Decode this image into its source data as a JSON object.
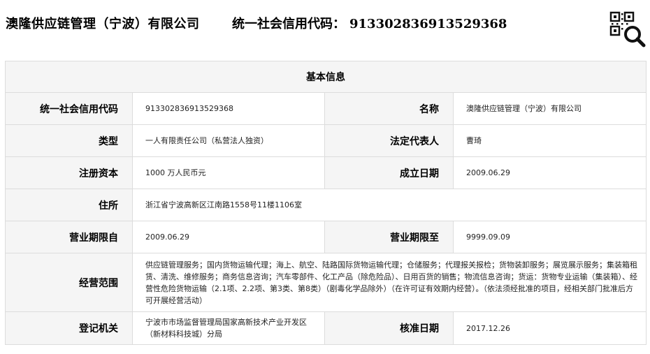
{
  "header": {
    "company_name": "澳隆供应链管理（宁波）有限公司",
    "credit_code_label": "统一社会信用代码：",
    "credit_code_value": "91330283691352936‌8",
    "qr_icon": "qr-code-search-icon"
  },
  "table": {
    "section_title": "基本信息",
    "rows": {
      "credit_code": {
        "label": "统一社会信用代码",
        "value": "913302836913529368"
      },
      "name": {
        "label": "名称",
        "value": "澳隆供应链管理（宁波）有限公司"
      },
      "type": {
        "label": "类型",
        "value": "一人有限责任公司（私营法人独资）"
      },
      "legal_rep": {
        "label": "法定代表人",
        "value": "曹琦"
      },
      "capital": {
        "label": "注册资本",
        "value": "1000 万人民币元"
      },
      "established": {
        "label": "成立日期",
        "value": "2009.06.29"
      },
      "address": {
        "label": "住所",
        "value": "浙江省宁波高新区江南路1558号11楼1106室"
      },
      "term_from": {
        "label": "营业期限自",
        "value": "2009.06.29"
      },
      "term_to": {
        "label": "营业期限至",
        "value": "9999.09.09"
      },
      "scope": {
        "label": "经营范围",
        "value": "供应链管理服务；国内货物运输代理；海上、航空、陆路国际货物运输代理；仓储服务；代理报关报检；货物装卸服务；展览展示服务；集装箱租赁、清洗、维修服务；商务信息咨询；汽车零部件、化工产品（除危险品）、日用百货的销售；物流信息咨询；货运：货物专业运输（集装箱）、经营性危险货物运输（2.1项、2.2项、第3类、第8类）（剧毒化学品除外）（在许可证有效期内经营）。（依法须经批准的项目，经相关部门批准后方可开展经营活动）"
      },
      "authority": {
        "label": "登记机关",
        "value": "宁波市市场监督管理局国家高新技术产业开发区（新材料科技城）分局"
      },
      "approval_date": {
        "label": "核准日期",
        "value": "2017.12.26"
      }
    }
  },
  "colors": {
    "label_background": "#f5f5f5",
    "border": "#dcdcdc"
  }
}
